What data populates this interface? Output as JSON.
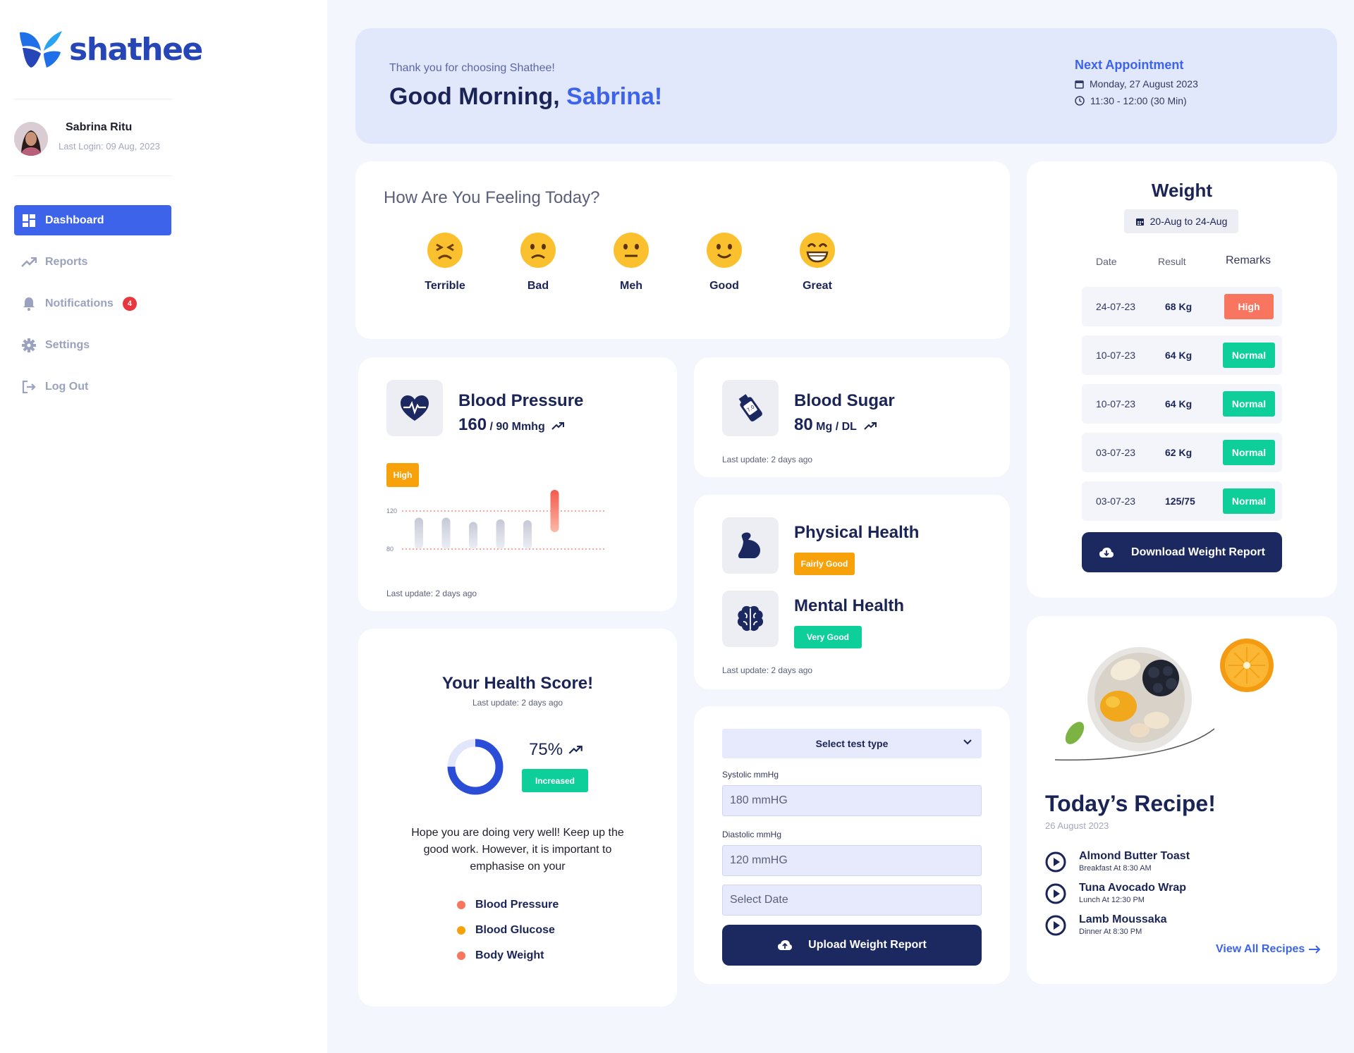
{
  "app": {
    "logo_text": "shathee"
  },
  "user": {
    "name": "Sabrina Ritu",
    "last_login": "Last Login: 09 Aug, 2023"
  },
  "nav": [
    {
      "label": "Dashboard",
      "active": true
    },
    {
      "label": "Reports"
    },
    {
      "label": "Notifications",
      "badge": "4"
    },
    {
      "label": "Settings"
    },
    {
      "label": "Log Out"
    }
  ],
  "hero": {
    "thanks": "Thank you for choosing Shathee!",
    "greeting": "Good Morning, ",
    "name": "Sabrina!",
    "appointment_title": "Next Appointment",
    "appointment_date": "Monday, 27 August 2023",
    "appointment_time": "11:30 - 12:00 (30 Min)"
  },
  "feeling": {
    "title": "How Are You Feeling Today?",
    "moods": [
      "Terrible",
      "Bad",
      "Meh",
      "Good",
      "Great"
    ]
  },
  "blood_pressure": {
    "title": "Blood Pressure",
    "value": "160",
    "unit": " / 90 Mmhg",
    "status": "High",
    "last_update": "Last update: 2 days ago",
    "chart_data": {
      "type": "bar",
      "y_labels": [
        "120",
        "80"
      ],
      "bar_levels": [
        0.72,
        0.72,
        0.62,
        0.68,
        0.66,
        1.0
      ],
      "highlight_index": 5
    }
  },
  "blood_sugar": {
    "title": "Blood Sugar",
    "value": "80",
    "unit": " Mg / DL",
    "last_update": "Last update: 2 days ago"
  },
  "physical": {
    "title": "Physical Health",
    "status": "Fairly Good"
  },
  "mental": {
    "title": "Mental Health",
    "status": "Very Good",
    "last_update": "Last update: 2 days ago"
  },
  "health_score": {
    "title": "Your Health Score!",
    "last_update": "Last update: 2 days ago",
    "percent": "75%",
    "percent_value": 75,
    "status": "Increased",
    "message": "Hope you are doing very well! Keep up the good work. However, it is important to emphasise on your",
    "items": [
      "Blood Pressure",
      "Blood Glucose",
      "Body Weight"
    ]
  },
  "upload_form": {
    "select_label": "Select test type",
    "systolic_label": "Systolic mmHg",
    "systolic_value": "180 mmHG",
    "diastolic_label": "Diastolic mmHg",
    "diastolic_value": "120 mmHG",
    "date_placeholder": "Select Date",
    "button": "Upload Weight Report"
  },
  "weight": {
    "title": "Weight",
    "range": "20-Aug to 24-Aug",
    "headers": [
      "Date",
      "Result",
      "Remarks"
    ],
    "rows": [
      {
        "date": "24-07-23",
        "result": "68 Kg",
        "remark": "High"
      },
      {
        "date": "10-07-23",
        "result": "64 Kg",
        "remark": "Normal"
      },
      {
        "date": "10-07-23",
        "result": "64 Kg",
        "remark": "Normal"
      },
      {
        "date": "03-07-23",
        "result": "62 Kg",
        "remark": "Normal"
      },
      {
        "date": "03-07-23",
        "result": "125/75",
        "remark": "Normal"
      }
    ],
    "button": "Download Weight Report"
  },
  "recipe": {
    "title": "Today’s Recipe!",
    "date": "26 August 2023",
    "items": [
      {
        "name": "Almond Butter Toast",
        "time": "Breakfast At 8:30 AM"
      },
      {
        "name": "Tuna Avocado Wrap",
        "time": "Lunch At 12:30 PM"
      },
      {
        "name": "Lamb Moussaka",
        "time": "Dinner At 8:30 PM"
      }
    ],
    "view_all": "View All Recipes"
  },
  "colors": {
    "primary": "#3d63ea",
    "navy": "#1c2961",
    "high": "#f8755f",
    "normal": "#0ecf9a",
    "orange": "#f7a10b"
  }
}
